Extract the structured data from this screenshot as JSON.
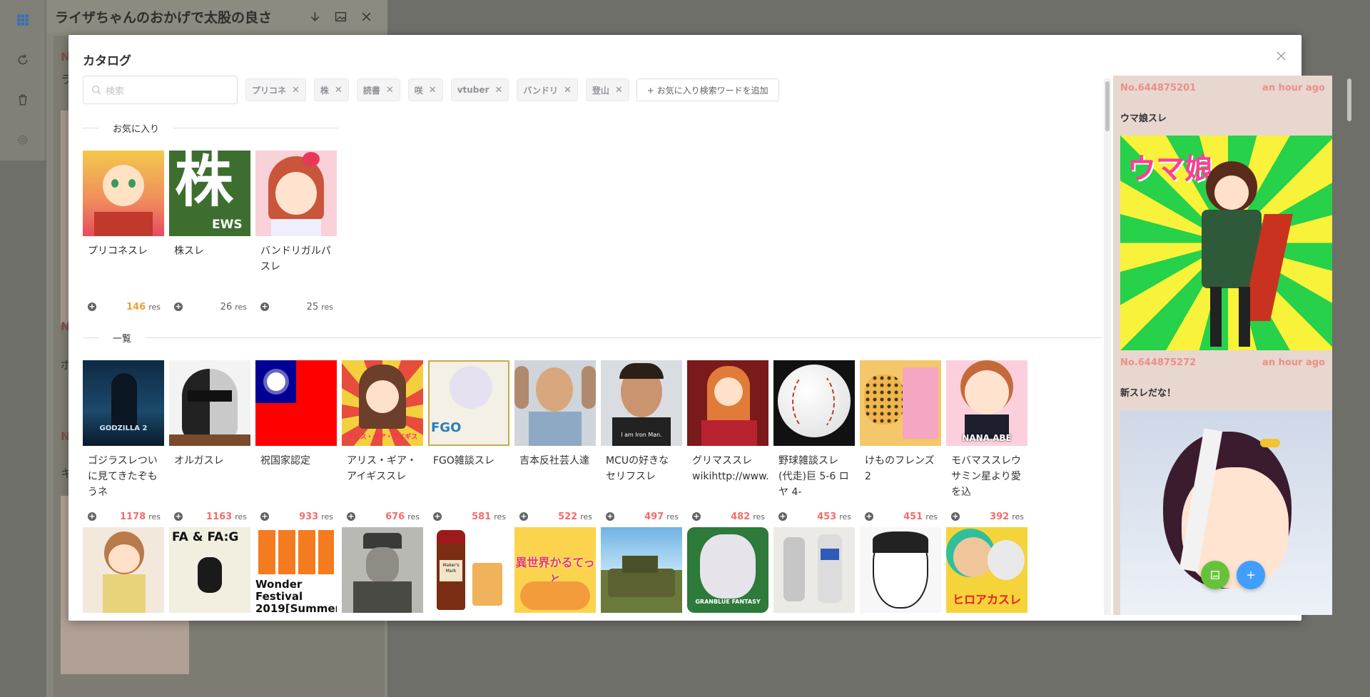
{
  "background": {
    "thread_title": "ライザちゃんのおかげで太股の良さ",
    "bg_nos": [
      "No",
      "No",
      "No"
    ],
    "bg_texts": [
      "ラ",
      "ボ",
      "キタ"
    ]
  },
  "modal": {
    "title": "カタログ",
    "search_placeholder": "検索",
    "tags": [
      "プリコネ",
      "株",
      "読書",
      "咲",
      "vtuber",
      "バンドリ",
      "登山"
    ],
    "add_favorite_label": "+ お気に入り検索ワードを追加",
    "favorites_heading": "お気に入り",
    "list_heading": "一覧",
    "favorites": [
      {
        "title": "プリコネスレ",
        "count": "146",
        "unit": "res",
        "color": "orange",
        "thumb": "prikone"
      },
      {
        "title": "株スレ",
        "count": "26",
        "unit": "res",
        "color": "gray",
        "thumb": "kabu"
      },
      {
        "title": "バンドリガルパスレ",
        "count": "25",
        "unit": "res",
        "color": "gray",
        "thumb": "bandori"
      }
    ],
    "catalog_row1": [
      {
        "title": "ゴジラスレついに見てきたぞもうネ",
        "count": "1178",
        "unit": "res",
        "thumb": "godzilla"
      },
      {
        "title": "オルガスレ",
        "count": "1163",
        "unit": "res",
        "thumb": "helmet"
      },
      {
        "title": "祝国家認定",
        "count": "933",
        "unit": "res",
        "thumb": "flag"
      },
      {
        "title": "アリス・ギア・アイギススレ",
        "count": "676",
        "unit": "res",
        "thumb": "alice"
      },
      {
        "title": "FGO雑談スレ",
        "count": "581",
        "unit": "res",
        "thumb": "fgo"
      },
      {
        "title": "吉本反社芸人達",
        "count": "522",
        "unit": "res",
        "thumb": "yoshimoto"
      },
      {
        "title": "MCUの好きなセリフスレ",
        "count": "497",
        "unit": "res",
        "thumb": "ironman"
      },
      {
        "title": "グリマススレwikihttp://www.mil",
        "count": "482",
        "unit": "res",
        "thumb": "grimas"
      },
      {
        "title": "野球雑談スレ(代走)巨 5-6 ロヤ 4-",
        "count": "453",
        "unit": "res",
        "thumb": "baseball"
      },
      {
        "title": "けものフレンズ2",
        "count": "451",
        "unit": "res",
        "thumb": "kemono"
      },
      {
        "title": "モバマススレウサミン星より愛を込",
        "count": "392",
        "unit": "res",
        "thumb": "nana"
      }
    ],
    "catalog_row2": [
      {
        "thumb": "ryza"
      },
      {
        "thumb": "fa"
      },
      {
        "thumb": "wonder"
      },
      {
        "thumb": "soldier"
      },
      {
        "thumb": "makers"
      },
      {
        "thumb": "isekai"
      },
      {
        "thumb": "tank"
      },
      {
        "thumb": "granblue"
      },
      {
        "thumb": "gundam"
      },
      {
        "thumb": "manga"
      },
      {
        "thumb": "hero"
      }
    ],
    "thumb_texts": {
      "kabu": "EWS",
      "godzilla": "GODZILLA 2",
      "alice": "アリス・ギア・アイギス",
      "fgo": "FGO",
      "ironman": "I am Iron Man.",
      "nana": "NANA ABE",
      "fa": "FA & FA:G",
      "wonder": "Wonder Festival 2019[Summer]",
      "makers": "Maker's Mark",
      "isekai": "異世界かるてっと",
      "granblue": "GRANBLUE FANTASY",
      "hero": "ヒロアカスレ",
      "umamusume_logo": "ウマ娘"
    }
  },
  "feed": {
    "posts": [
      {
        "no": "No.644875201",
        "time": "an hour ago",
        "text": "ウマ娘スレ"
      },
      {
        "no": "No.644875272",
        "time": "an hour ago",
        "text": "新スレだな！"
      }
    ]
  },
  "colors": {
    "accent_red": "#f56c6c",
    "accent_orange": "#e6a23c",
    "feed_bg": "#e8d7cf",
    "fab_green": "#67c23a",
    "fab_blue": "#409eff"
  }
}
